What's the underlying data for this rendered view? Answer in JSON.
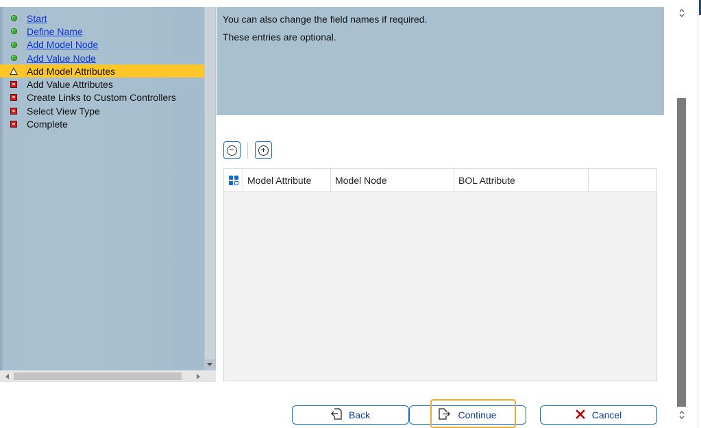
{
  "wizard": {
    "steps": [
      {
        "label": "Start",
        "status": "done",
        "link": true
      },
      {
        "label": "Define Name",
        "status": "done",
        "link": true
      },
      {
        "label": "Add Model Node",
        "status": "done",
        "link": true
      },
      {
        "label": "Add Value Node",
        "status": "done",
        "link": true
      },
      {
        "label": "Add Model Attributes",
        "status": "current",
        "link": false
      },
      {
        "label": "Add Value Attributes",
        "status": "pending",
        "link": false
      },
      {
        "label": "Create Links to Custom Controllers",
        "status": "pending",
        "link": false
      },
      {
        "label": "Select View Type",
        "status": "pending",
        "link": false
      },
      {
        "label": "Complete",
        "status": "pending",
        "link": false
      }
    ]
  },
  "info": {
    "line1": "You can also change the field names if required.",
    "line2": "These entries are optional."
  },
  "table": {
    "columns": [
      "Model Attribute",
      "Model Node",
      "BOL Attribute",
      ""
    ],
    "rows": []
  },
  "footer": {
    "back_label": "Back",
    "continue_label": "Continue",
    "cancel_label": "Cancel"
  },
  "colors": {
    "accent": "#0a6ed1",
    "current_step": "#ffc629",
    "panel_bg": "#a9c0d0",
    "focus": "#f0ab36",
    "cancel_icon": "#bb0000"
  }
}
